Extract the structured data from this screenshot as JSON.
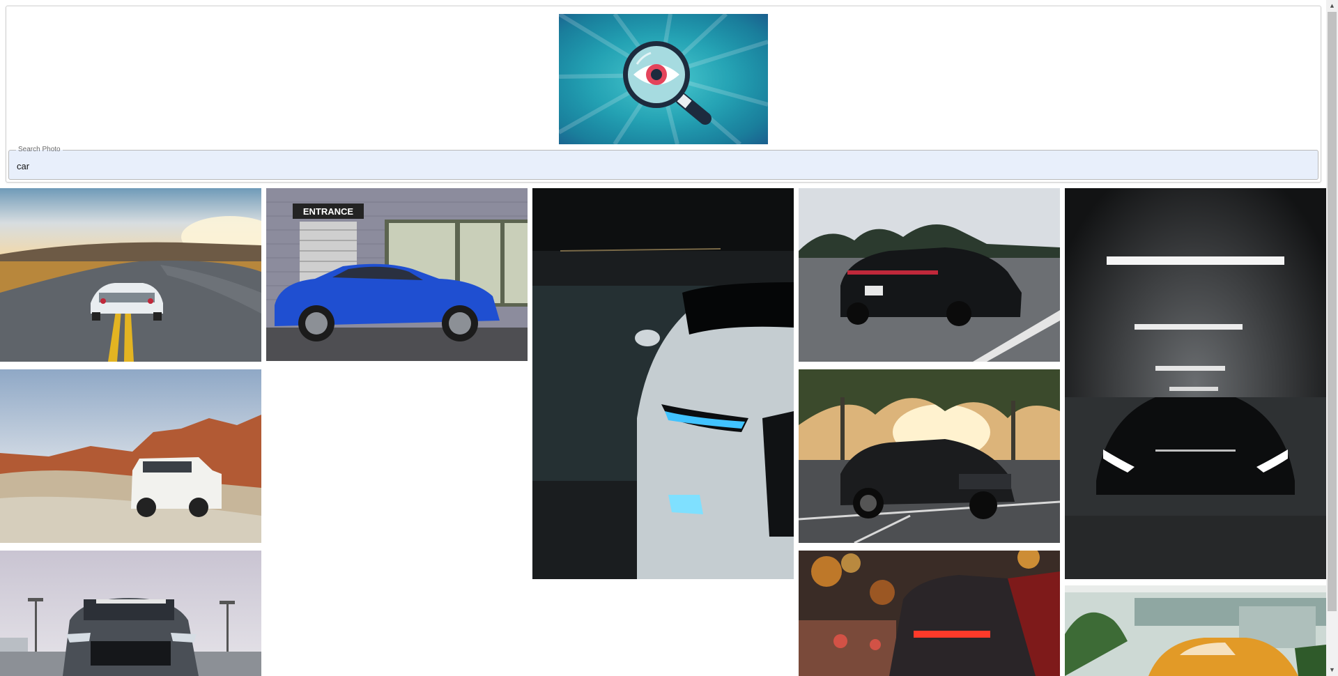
{
  "header": {
    "logo_icon": "magnifier-eye-icon",
    "search": {
      "label": "Search Photo",
      "value": "car"
    }
  },
  "photos": [
    {
      "name": "photo-gt-r-desert-road",
      "subject": "white sports car on winding road at sunset"
    },
    {
      "name": "photo-blue-coupe-entrance",
      "subject": "blue coupe parked by building entrance"
    },
    {
      "name": "photo-white-audi-headlight",
      "subject": "white car headlight in dark garage"
    },
    {
      "name": "photo-black-porsche-highway",
      "subject": "black sedan on highway"
    },
    {
      "name": "photo-black-car-garage-lights",
      "subject": "black car under garage lights"
    },
    {
      "name": "photo-white-suv-desert",
      "subject": "white SUV in red rock desert"
    },
    {
      "name": "photo-black-mustang-parking",
      "subject": "black muscle car in parking lot"
    },
    {
      "name": "photo-grey-mustang-front",
      "subject": "grey muscle car front view"
    },
    {
      "name": "photo-red-taillights-city",
      "subject": "sports car taillights in city street"
    },
    {
      "name": "photo-orange-beetle",
      "subject": "orange vintage beetle"
    }
  ],
  "logo_text": "ENTRANCE",
  "colors": {
    "accent": "#1ea5b4",
    "search_bg": "#e8effb"
  },
  "scrollbar": {
    "up_icon": "scroll-up-arrow-icon",
    "down_icon": "scroll-down-arrow-icon"
  }
}
